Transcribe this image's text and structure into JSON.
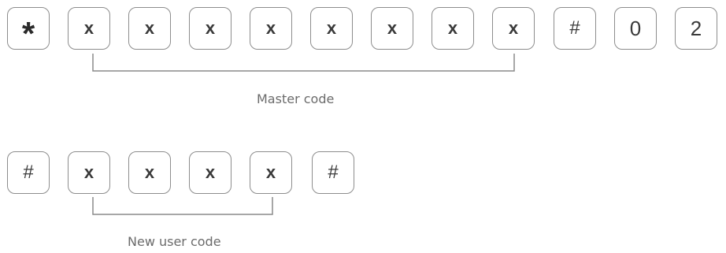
{
  "sequence_master": {
    "keys": [
      {
        "label": "*",
        "kind": "star"
      },
      {
        "label": "x",
        "kind": "x"
      },
      {
        "label": "x",
        "kind": "x"
      },
      {
        "label": "x",
        "kind": "x"
      },
      {
        "label": "x",
        "kind": "x"
      },
      {
        "label": "x",
        "kind": "x"
      },
      {
        "label": "x",
        "kind": "x"
      },
      {
        "label": "x",
        "kind": "x"
      },
      {
        "label": "x",
        "kind": "x"
      },
      {
        "label": "#",
        "kind": "hash"
      },
      {
        "label": "0",
        "kind": "num"
      },
      {
        "label": "2",
        "kind": "num"
      }
    ],
    "caption": "Master code"
  },
  "sequence_user": {
    "keys": [
      {
        "label": "#",
        "kind": "hash"
      },
      {
        "label": "x",
        "kind": "x"
      },
      {
        "label": "x",
        "kind": "x"
      },
      {
        "label": "x",
        "kind": "x"
      },
      {
        "label": "x",
        "kind": "x"
      },
      {
        "label": "#",
        "kind": "hash"
      }
    ],
    "caption": "New user code"
  },
  "colors": {
    "key_border": "#8d8d8d",
    "key_text": "#3a3a3a",
    "bracket": "#8a8a8a",
    "caption": "#6b6b6b"
  }
}
